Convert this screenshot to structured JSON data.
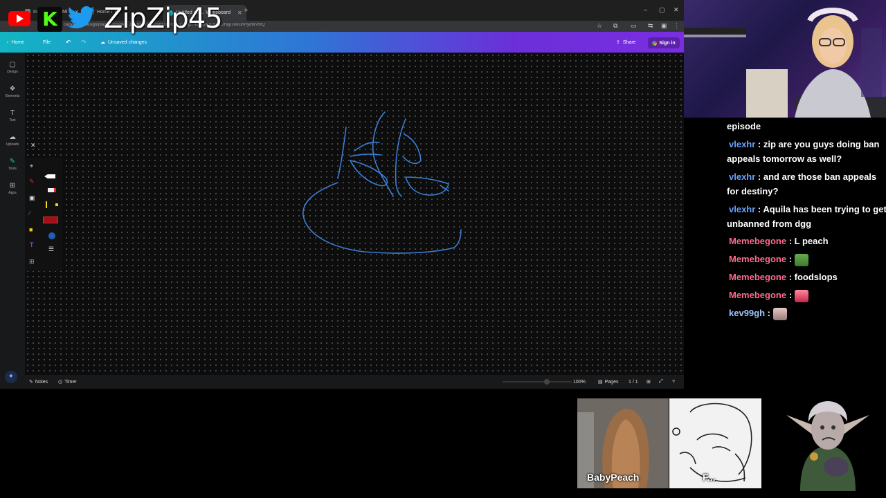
{
  "overlay": {
    "channel_name": "ZipZip45"
  },
  "browser": {
    "tabs": [
      {
        "label": "Info"
      },
      {
        "label": "Mi"
      },
      {
        "label": "Home / Tw"
      },
      {
        "label": "Untitled de ... Whiteboard"
      }
    ],
    "new_tab": "+",
    "url": "canva.com/design/play?template=...Ijp7IkliOnsiQil6dHJ1ZX19LCJ9Ijp7IkE_ljoiUCI9LCJHijp7IkliOnRydWV9fQ",
    "window_controls": [
      "–",
      "▢",
      "✕"
    ]
  },
  "canva": {
    "home": "Home",
    "file": "File",
    "status": "Unsaved changes",
    "share": "Share",
    "sign_in": "Sign in",
    "rail": [
      {
        "label": "Design",
        "icon": "design-icon",
        "glyph": "▢"
      },
      {
        "label": "Elements",
        "icon": "elements-icon",
        "glyph": "❖"
      },
      {
        "label": "Text",
        "icon": "text-icon",
        "glyph": "T"
      },
      {
        "label": "Uploads",
        "icon": "uploads-icon",
        "glyph": "☁"
      },
      {
        "label": "Tools",
        "icon": "tools-icon",
        "glyph": "✎"
      },
      {
        "label": "Apps",
        "icon": "apps-icon",
        "glyph": "⊞"
      }
    ],
    "bottom": {
      "notes": "Notes",
      "timer": "Timer",
      "zoom": "100%",
      "pages": "Pages",
      "page_count": "1 / 1"
    },
    "accent_colors": {
      "pen_blue": "#3a7fd6",
      "pen_red": "#e0262b",
      "header_start": "#13b5c4",
      "header_end": "#7a2ee0"
    }
  },
  "chat": {
    "messages": [
      {
        "user": "",
        "text": "episode",
        "color": "#ffffff"
      },
      {
        "user": "vlexhr",
        "text": "zip are you guys doing ban appeals tomorrow as well?",
        "color": "#6aa2ff"
      },
      {
        "user": "vlexhr",
        "text": "and are those ban appeals for destiny?",
        "color": "#6aa2ff"
      },
      {
        "user": "vlexhr",
        "text": "Aquila has been trying to get unbanned from dgg",
        "color": "#6aa2ff"
      },
      {
        "user": "Memebegone",
        "text": "L peach",
        "color": "#ff6a8f"
      },
      {
        "user": "Memebegone",
        "text": "",
        "emote": "pepe-emote",
        "color": "#ff6a8f"
      },
      {
        "user": "Memebegone",
        "text": "foodslops",
        "color": "#ff6a8f"
      },
      {
        "user": "Memebegone",
        "text": "",
        "emote": "lips-emote",
        "color": "#ff6a8f"
      },
      {
        "user": "kev99gh",
        "text": "",
        "emote": "cat-emote",
        "color": "#9fc7ff"
      }
    ],
    "separator": " : "
  },
  "costreamers": {
    "babypeach": "BabyPeach",
    "sketch": "F..."
  }
}
